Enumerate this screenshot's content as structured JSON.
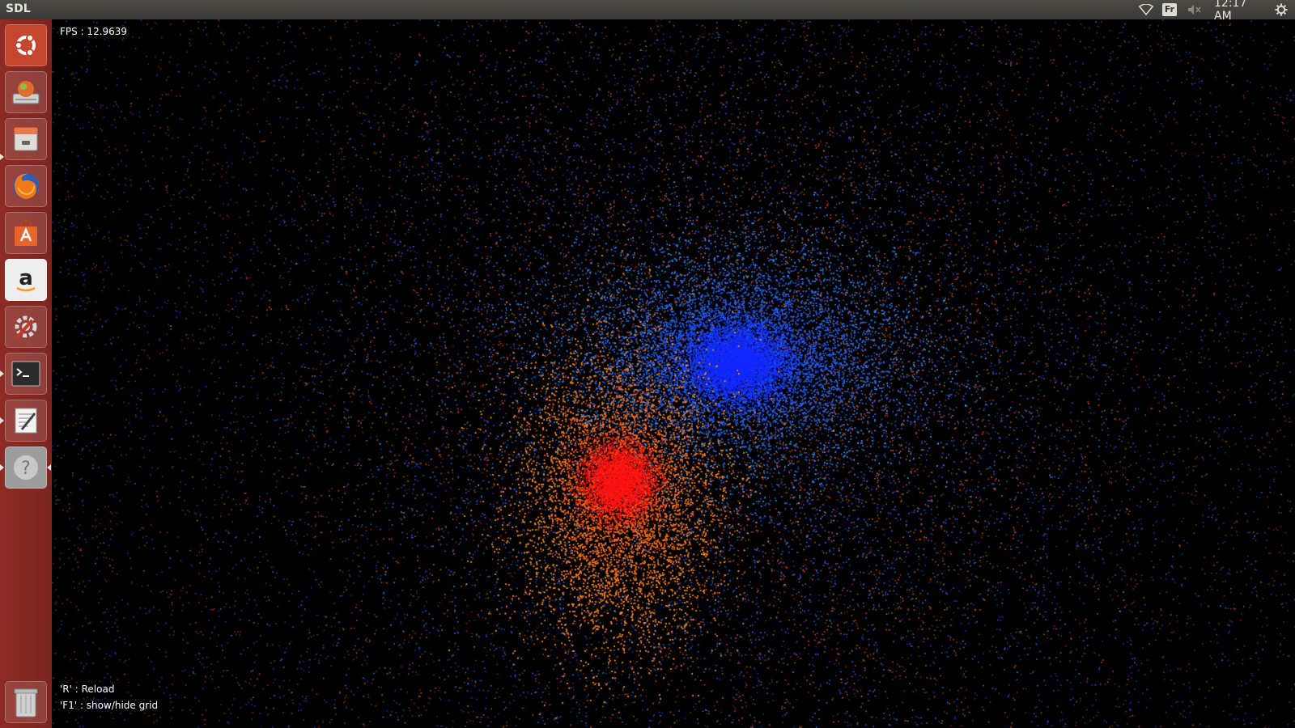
{
  "window": {
    "title": "SDL"
  },
  "tray": {
    "wifi_icon": "wifi-icon",
    "keyboard_layout": "Fr",
    "volume_icon": "volume-muted-icon",
    "clock": "12:17 AM",
    "settings_icon": "gear-icon"
  },
  "launcher": {
    "items": [
      {
        "name": "ubuntu-dash",
        "icon": "ubuntu-logo-icon"
      },
      {
        "name": "backup",
        "icon": "backup-icon"
      },
      {
        "name": "file-manager",
        "icon": "file-cabinet-icon"
      },
      {
        "name": "firefox",
        "icon": "firefox-icon"
      },
      {
        "name": "software-center",
        "icon": "shopping-bag-icon"
      },
      {
        "name": "amazon",
        "icon": "amazon-icon"
      },
      {
        "name": "system-settings",
        "icon": "wrench-gear-icon"
      },
      {
        "name": "terminal",
        "icon": "terminal-icon"
      },
      {
        "name": "text-editor",
        "icon": "text-editor-icon"
      },
      {
        "name": "help",
        "icon": "help-icon"
      }
    ],
    "trash_icon": "trash-icon"
  },
  "simulation": {
    "fps_text": "FPS : 12.9639",
    "help_reload": "'R' : Reload",
    "help_grid": "'F1' : show/hide grid",
    "colors": {
      "cluster_a": "#1e6bff",
      "cluster_b": "#ff4a1a",
      "background": "#000000"
    }
  }
}
